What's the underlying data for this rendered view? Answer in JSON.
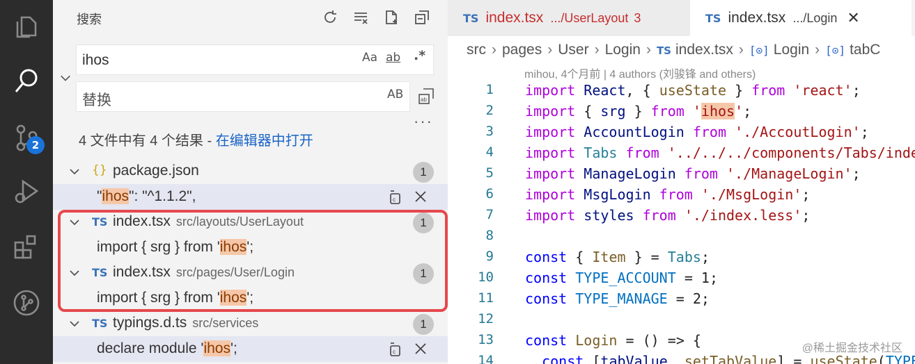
{
  "activity_bar": {
    "scm_badge": "2"
  },
  "sidebar": {
    "title": "搜索",
    "search_value": "ihos",
    "match_case": "Aa",
    "whole_word": "ab",
    "regex": ".*",
    "replace_placeholder": "替换",
    "preserve_case": "AB",
    "more": "···",
    "summary": "4 文件中有 4 个结果 - ",
    "open_in_editor": "在编辑器中打开",
    "results": [
      {
        "icon": "{}",
        "name": "package.json",
        "path": "",
        "count": "1",
        "match": {
          "pre": "\"",
          "hit": "ihos",
          "post": "\": \"^1.1.2\","
        }
      },
      {
        "icon": "TS",
        "name": "index.tsx",
        "path": "src/layouts/UserLayout",
        "count": "1",
        "match": {
          "pre": "import { srg } from '",
          "hit": "ihos",
          "post": "';"
        }
      },
      {
        "icon": "TS",
        "name": "index.tsx",
        "path": "src/pages/User/Login",
        "count": "1",
        "match": {
          "pre": "import { srg } from '",
          "hit": "ihos",
          "post": "';"
        }
      },
      {
        "icon": "TS",
        "name": "typings.d.ts",
        "path": "src/services",
        "count": "1",
        "match": {
          "pre": "declare module '",
          "hit": "ihos",
          "post": "';"
        }
      }
    ]
  },
  "editor": {
    "tabs": [
      {
        "icon": "TS",
        "name": "index.tsx",
        "path": ".../UserLayout",
        "problems": "3"
      },
      {
        "icon": "TS",
        "name": "index.tsx",
        "path": ".../Login",
        "close": "✕"
      }
    ],
    "breadcrumb": [
      "src",
      "pages",
      "User",
      "Login",
      "index.tsx",
      "Login",
      "tabC"
    ],
    "blame": "mihou, 4个月前 | 4 authors (刘骏锋 and others)",
    "line_numbers": [
      "1",
      "2",
      "3",
      "4",
      "5",
      "6",
      "7",
      "8",
      "9",
      "10",
      "11",
      "12",
      "13",
      "14"
    ],
    "code_lines": [
      "import React, { useState } from 'react';",
      "import { srg } from 'ihos';",
      "import AccountLogin from './AccoutLogin';",
      "import Tabs from '../../../components/Tabs/index';",
      "import ManageLogin from './ManageLogin';",
      "import MsgLogin from './MsgLogin';",
      "import styles from './index.less';",
      "",
      "const { Item } = Tabs;",
      "const TYPE_ACCOUNT = 1;",
      "const TYPE_MANAGE = 2;",
      "",
      "const Login = () => {",
      "  const [tabValue, setTabValue] = useState(TYPE"
    ]
  },
  "watermark": "@稀土掘金技术社区"
}
